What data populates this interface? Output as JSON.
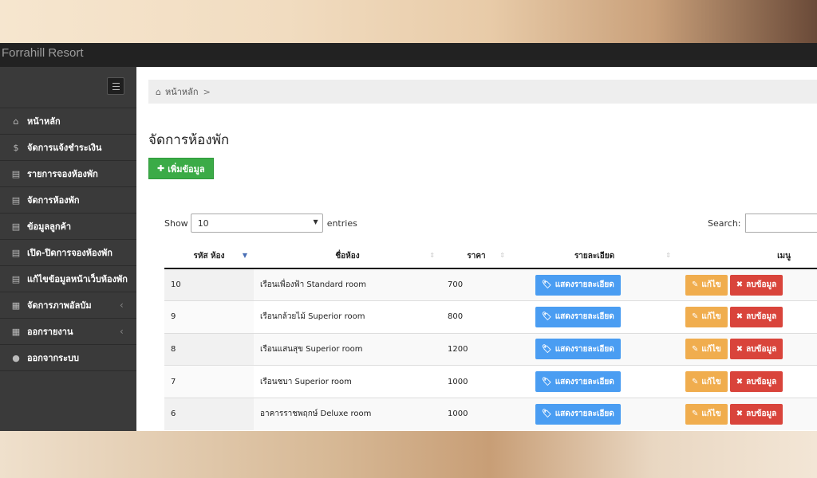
{
  "app": {
    "title": "Forrahill Resort"
  },
  "sidebar": {
    "items": [
      {
        "label": "หน้าหลัก",
        "icon": "home-icon",
        "glyph": "⌂",
        "has_submenu": false
      },
      {
        "label": "จัดการแจ้งชำระเงิน",
        "icon": "dollar-icon",
        "glyph": "$",
        "has_submenu": false
      },
      {
        "label": "รายการจองห้องพัก",
        "icon": "book-icon",
        "glyph": "▤",
        "has_submenu": false
      },
      {
        "label": "จัดการห้องพัก",
        "icon": "book-icon",
        "glyph": "▤",
        "has_submenu": false
      },
      {
        "label": "ข้อมูลลูกค้า",
        "icon": "book-icon",
        "glyph": "▤",
        "has_submenu": false
      },
      {
        "label": "เปิด-ปิดการจองห้องพัก",
        "icon": "book-icon",
        "glyph": "▤",
        "has_submenu": false
      },
      {
        "label": "แก้ไขข้อมูลหน้าเว็บห้องพัก",
        "icon": "book-icon",
        "glyph": "▤",
        "has_submenu": false
      },
      {
        "label": "จัดการภาพอัลบัม",
        "icon": "table-icon",
        "glyph": "▦",
        "has_submenu": true
      },
      {
        "label": "ออกรายงาน",
        "icon": "table-icon",
        "glyph": "▦",
        "has_submenu": true
      },
      {
        "label": "ออกจากระบบ",
        "icon": "user-icon",
        "glyph": "●",
        "has_submenu": false
      }
    ]
  },
  "breadcrumb": {
    "home_label": "หน้าหลัก",
    "separator": ">"
  },
  "page": {
    "title": "จัดการห้องพัก",
    "add_button": "เพิ่มข้อมูล"
  },
  "table_controls": {
    "show_label": "Show",
    "entries_value": "10",
    "entries_label": "entries",
    "search_label": "Search:"
  },
  "table": {
    "columns": [
      "รหัส ห้อง",
      "ชื่อห้อง",
      "ราคา",
      "รายละเอียด",
      "เมนู"
    ],
    "rows": [
      {
        "id": "10",
        "name": "เรือนเพื่องฟ้า Standard room",
        "price": "700",
        "detail": "แสดงรายละเอียด",
        "edit": "แก้ไข",
        "delete": "ลบข้อมูล"
      },
      {
        "id": "9",
        "name": "เรือนกล้วยไม้ Superior room",
        "price": "800",
        "detail": "แสดงรายละเอียด",
        "edit": "แก้ไข",
        "delete": "ลบข้อมูล"
      },
      {
        "id": "8",
        "name": "เรือนแสนสุข Superior room",
        "price": "1200",
        "detail": "แสดงรายละเอียด",
        "edit": "แก้ไข",
        "delete": "ลบข้อมูล"
      },
      {
        "id": "7",
        "name": "เรือนชบา Superior room",
        "price": "1000",
        "detail": "แสดงรายละเอียด",
        "edit": "แก้ไข",
        "delete": "ลบข้อมูล"
      },
      {
        "id": "6",
        "name": "อาคารราชพฤกษ์ Deluxe room",
        "price": "1000",
        "detail": "แสดงรายละเอียด",
        "edit": "แก้ไข",
        "delete": "ลบข้อมูล"
      }
    ]
  },
  "colors": {
    "topbar": "#222222",
    "sidebar": "#3a3a3a",
    "success": "#3bab47",
    "info": "#4a9df2",
    "warning": "#f0ad4e",
    "danger": "#d9443b"
  }
}
